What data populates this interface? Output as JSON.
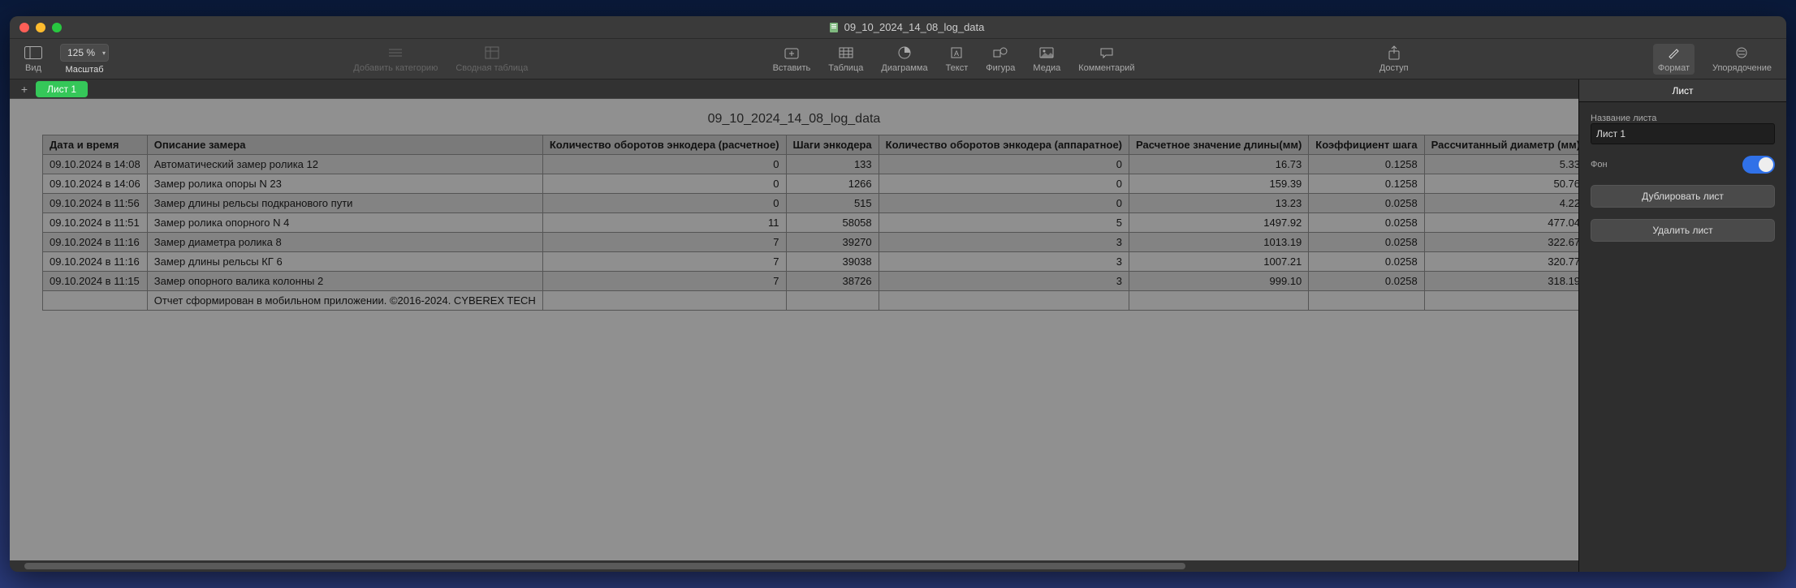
{
  "window": {
    "title": "09_10_2024_14_08_log_data"
  },
  "toolbar": {
    "view_label": "Вид",
    "zoom_label": "Масштаб",
    "zoom_value": "125 %",
    "add_category": "Добавить категорию",
    "pivot": "Сводная таблица",
    "insert": "Вставить",
    "table": "Таблица",
    "chart": "Диаграмма",
    "text": "Текст",
    "shape": "Фигура",
    "media": "Медиа",
    "comment": "Комментарий",
    "share": "Доступ",
    "format": "Формат",
    "organize": "Упорядочение"
  },
  "sheets": {
    "active": "Лист 1"
  },
  "doc_title": "09_10_2024_14_08_log_data",
  "headers": [
    "Дата и время",
    "Описание замера",
    "Количество оборотов энкодера (расчетное)",
    "Шаги энкодера",
    "Количество оборотов энкодера (аппаратное)",
    "Расчетное значение длины(мм)",
    "Коэффициент шага",
    "Рассчитанный диаметр (мм)"
  ],
  "rows": [
    {
      "dt": "09.10.2024 в 14:08",
      "desc": "Автоматический замер ролика 12",
      "c1": "0",
      "c2": "133",
      "c3": "0",
      "c4": "16.73",
      "c5": "0.1258",
      "c6": "5.33"
    },
    {
      "dt": "09.10.2024 в 14:06",
      "desc": "Замер ролика опоры N 23",
      "c1": "0",
      "c2": "1266",
      "c3": "0",
      "c4": "159.39",
      "c5": "0.1258",
      "c6": "50.76"
    },
    {
      "dt": "09.10.2024 в 11:56",
      "desc": "Замер длины рельсы подкранового пути",
      "c1": "0",
      "c2": "515",
      "c3": "0",
      "c4": "13.23",
      "c5": "0.0258",
      "c6": "4.22"
    },
    {
      "dt": "09.10.2024 в 11:51",
      "desc": "Замер ролика опорного N 4",
      "c1": "11",
      "c2": "58058",
      "c3": "5",
      "c4": "1497.92",
      "c5": "0.0258",
      "c6": "477.04"
    },
    {
      "dt": "09.10.2024 в 11:16",
      "desc": "Замер диаметра ролика 8",
      "c1": "7",
      "c2": "39270",
      "c3": "3",
      "c4": "1013.19",
      "c5": "0.0258",
      "c6": "322.67"
    },
    {
      "dt": "09.10.2024 в 11:16",
      "desc": "Замер длины рельсы КГ 6",
      "c1": "7",
      "c2": "39038",
      "c3": "3",
      "c4": "1007.21",
      "c5": "0.0258",
      "c6": "320.77"
    },
    {
      "dt": "09.10.2024 в 11:15",
      "desc": "Замер опорного валика колонны 2",
      "c1": "7",
      "c2": "38726",
      "c3": "3",
      "c4": "999.10",
      "c5": "0.0258",
      "c6": "318.19"
    }
  ],
  "footer_row": "Отчет сформирован в мобильном приложении. ©2016-2024. CYBEREX TECH",
  "inspector": {
    "tab_sheet": "Лист",
    "sheet_name_label": "Название листа",
    "sheet_name_value": "Лист 1",
    "bg_label": "Фон",
    "duplicate": "Дублировать лист",
    "delete": "Удалить лист"
  }
}
